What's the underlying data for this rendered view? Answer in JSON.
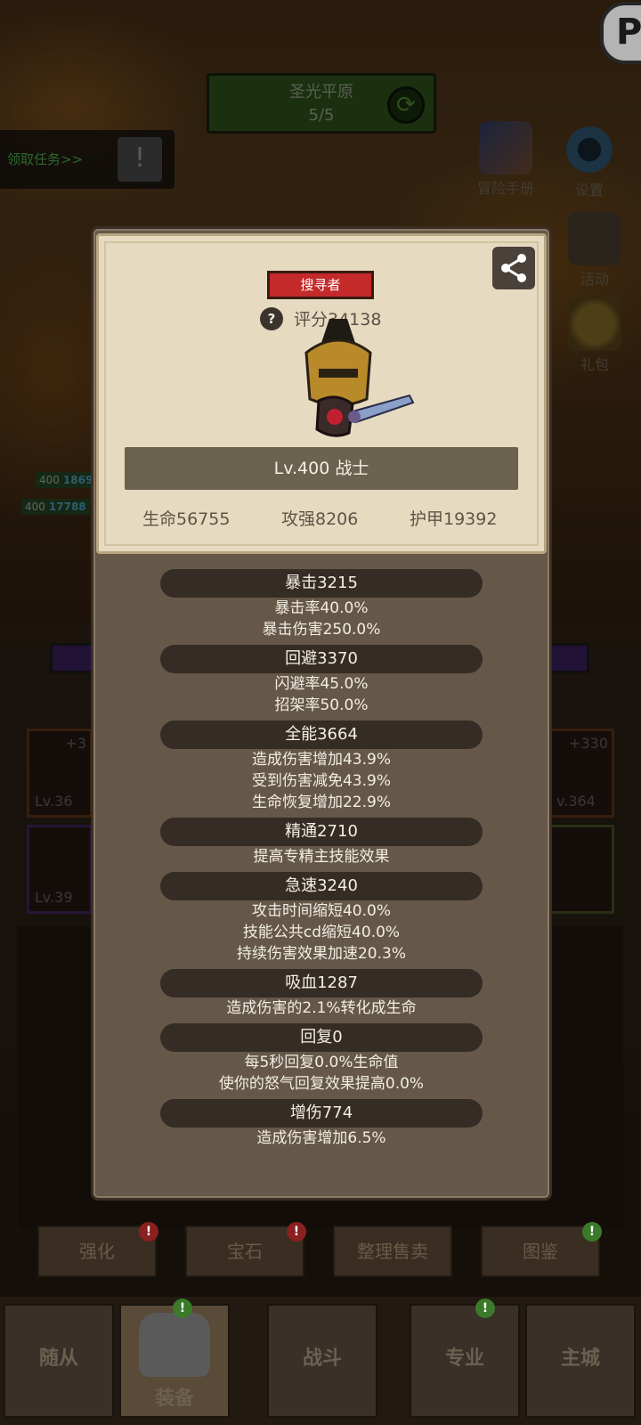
{
  "stage": {
    "name": "圣光平原",
    "progress": "5/5"
  },
  "task": {
    "label": "领取任务>>"
  },
  "side_menu": [
    {
      "label": "冒险手册",
      "icon": "adventure-book-icon"
    },
    {
      "label": "设置",
      "icon": "gear-icon"
    },
    {
      "label": "活动",
      "icon": "event-board-icon"
    },
    {
      "label": "礼包",
      "icon": "gift-bag-icon"
    }
  ],
  "corner_badge": "P",
  "team_levels": [
    {
      "level": "400",
      "value": "1869"
    },
    {
      "level": "400",
      "value": "17788"
    }
  ],
  "equipment_slots": [
    {
      "plus": "+3",
      "level": "Lv.36"
    },
    {
      "plus": "",
      "level": "Lv.39"
    },
    {
      "plus": "+330",
      "level": "v.364"
    }
  ],
  "character": {
    "class_tag": "搜寻者",
    "score": "评分34138",
    "level_title": "Lv.400 战士",
    "health": "生命56755",
    "attack": "攻强8206",
    "armor": "护甲19392"
  },
  "stats": [
    {
      "header": "暴击3215",
      "lines": [
        "暴击率40.0%",
        "暴击伤害250.0%"
      ]
    },
    {
      "header": "回避3370",
      "lines": [
        "闪避率45.0%",
        "招架率50.0%"
      ]
    },
    {
      "header": "全能3664",
      "lines": [
        "造成伤害增加43.9%",
        "受到伤害减免43.9%",
        "生命恢复增加22.9%"
      ]
    },
    {
      "header": "精通2710",
      "lines": [
        "提高专精主技能效果"
      ]
    },
    {
      "header": "急速3240",
      "lines": [
        "攻击时间缩短40.0%",
        "技能公共cd缩短40.0%",
        "持续伤害效果加速20.3%"
      ]
    },
    {
      "header": "吸血1287",
      "lines": [
        "造成伤害的2.1%转化成生命"
      ]
    },
    {
      "header": "回复0",
      "lines": [
        "每5秒回复0.0%生命值",
        "使你的怒气回复效果提高0.0%"
      ]
    },
    {
      "header": "增伤774",
      "lines": [
        "造成伤害增加6.5%"
      ]
    }
  ],
  "action_buttons": [
    {
      "label": "强化",
      "badge": "!",
      "badge_color": "#8a2020"
    },
    {
      "label": "宝石",
      "badge": "!",
      "badge_color": "#8a2020"
    },
    {
      "label": "整理售卖",
      "badge": "",
      "badge_color": ""
    },
    {
      "label": "图鉴",
      "badge": "!",
      "badge_color": "#3a7a2a"
    }
  ],
  "bottom_nav": [
    {
      "label": "随从"
    },
    {
      "label": "装备",
      "active": true
    },
    {
      "label": "战斗"
    },
    {
      "label": "专业"
    },
    {
      "label": "主城"
    }
  ]
}
